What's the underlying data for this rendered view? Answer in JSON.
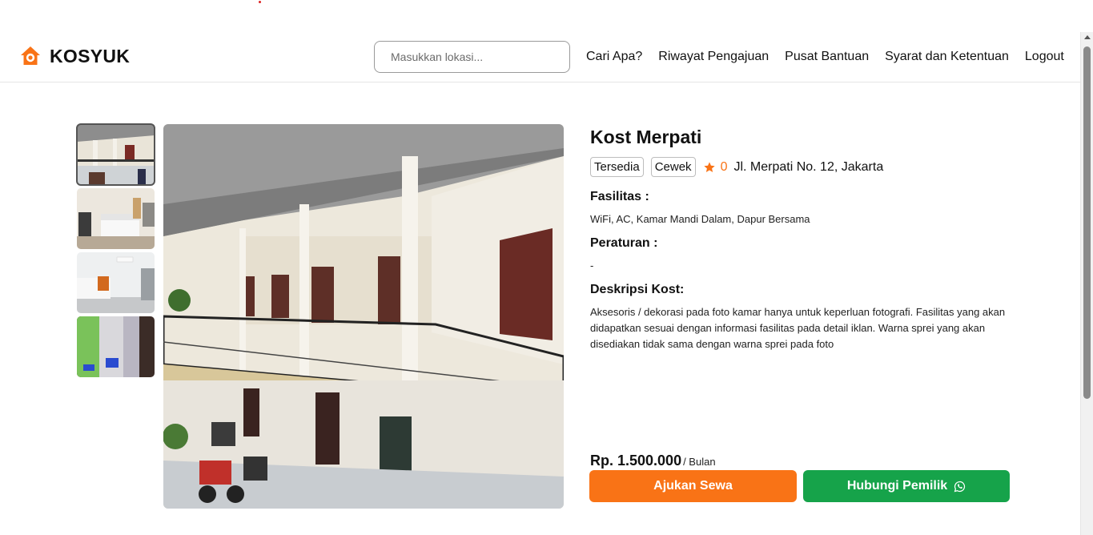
{
  "header": {
    "brand": "KOSYUK",
    "search_placeholder": "Masukkan lokasi...",
    "nav": [
      "Cari Apa?",
      "Riwayat Pengajuan",
      "Pusat Bantuan",
      "Syarat dan Ketentuan",
      "Logout"
    ]
  },
  "gallery": {
    "thumbnails": [
      "kost-corridor-photo",
      "bedroom-photo-1",
      "bedroom-photo-2",
      "bathroom-photo"
    ],
    "active_index": 0
  },
  "kost": {
    "name": "Kost Merpati",
    "badges": [
      "Tersedia",
      "Cewek"
    ],
    "rating": "0",
    "address": "Jl. Merpati No. 12, Jakarta",
    "facilities_label": "Fasilitas :",
    "facilities": "WiFi, AC, Kamar Mandi Dalam, Dapur Bersama",
    "rules_label": "Peraturan :",
    "rules": "-",
    "description_label": "Deskripsi Kost:",
    "description": "Aksesoris / dekorasi pada foto kamar hanya untuk keperluan fotografi. Fasilitas yang akan didapatkan sesuai dengan informasi fasilitas pada detail iklan. Warna sprei yang akan disediakan tidak sama dengan warna sprei pada foto",
    "price": "Rp. 1.500.000",
    "price_unit": "/ Bulan"
  },
  "actions": {
    "apply_label": "Ajukan Sewa",
    "contact_label": "Hubungi Pemilik"
  },
  "colors": {
    "accent": "#f97316",
    "contact": "#16a34a"
  }
}
